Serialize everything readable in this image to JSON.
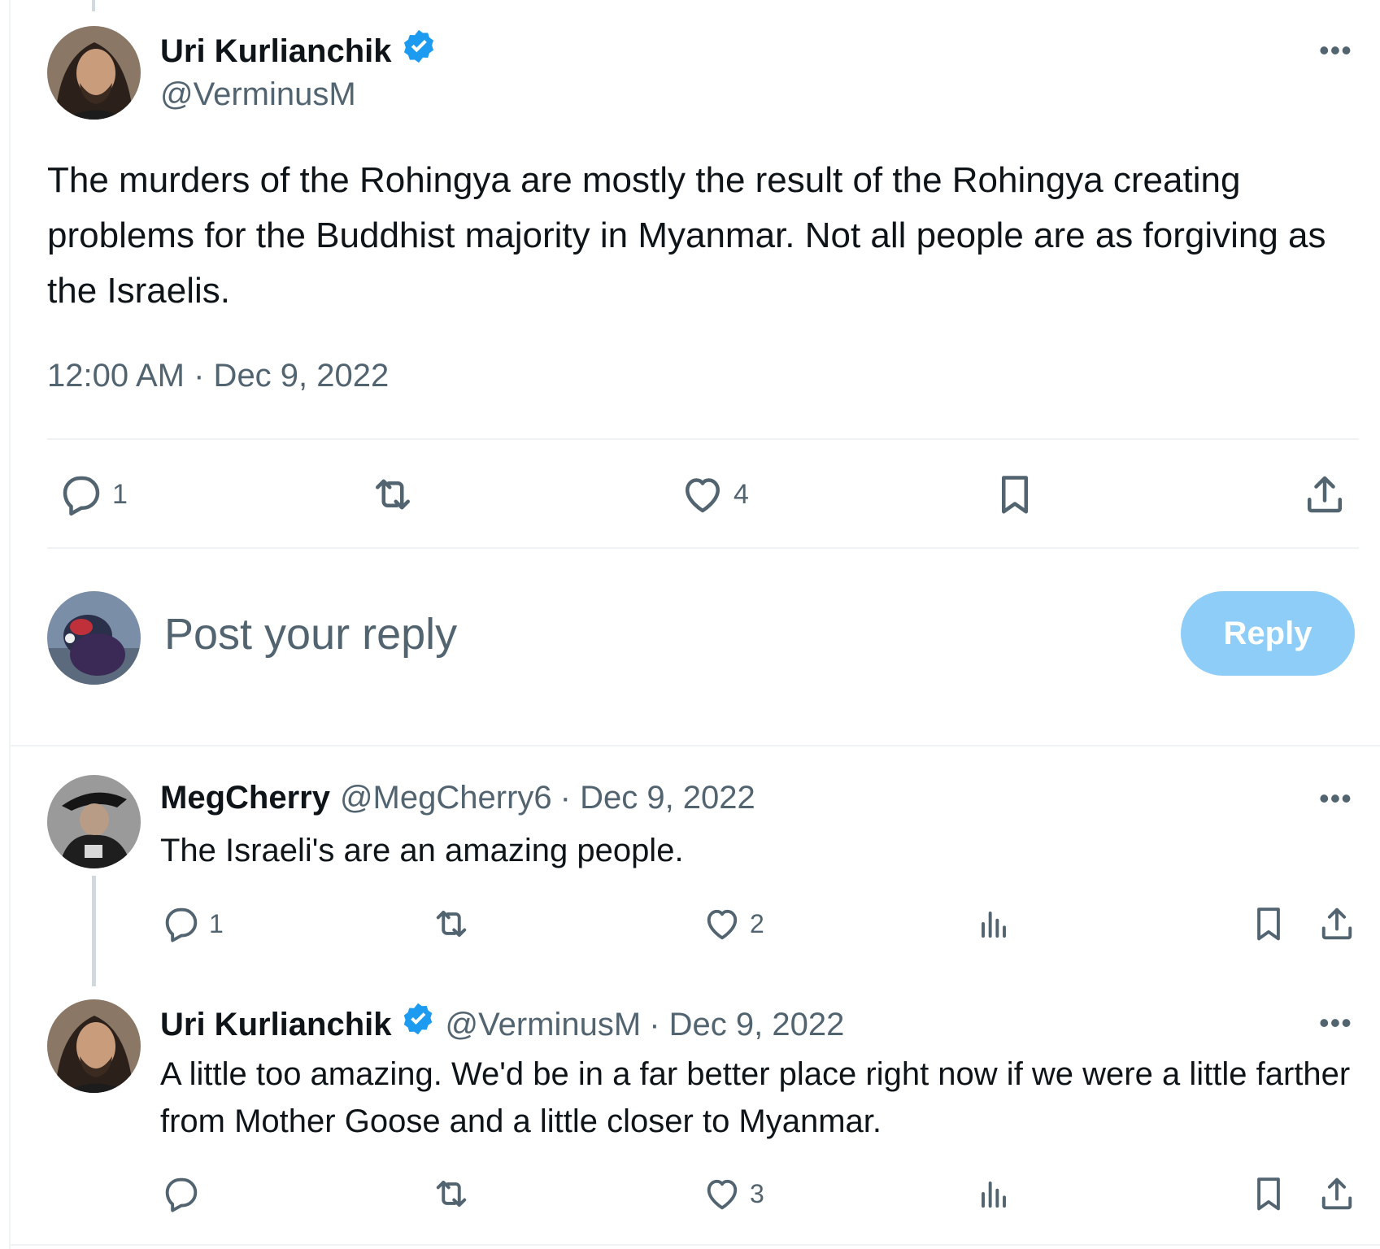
{
  "main_post": {
    "author_name": "Uri Kurlianchik",
    "author_handle": "@VerminusM",
    "verified": true,
    "text": "The murders of the Rohingya are mostly the result of the Rohingya creating problems for the Buddhist majority in Myanmar. Not all people are as forgiving as the Israelis.",
    "timestamp": "12:00 AM · Dec 9, 2022",
    "actions": {
      "reply_count": "1",
      "like_count": "4"
    }
  },
  "composer": {
    "placeholder": "Post your reply",
    "button_label": "Reply"
  },
  "replies": [
    {
      "author_name": "MegCherry",
      "author_handle": "@MegCherry6",
      "meta_sep_date": "· Dec 9, 2022",
      "text": "The Israeli's are an amazing people.",
      "reply_count": "1",
      "like_count": "2"
    },
    {
      "author_name": "Uri Kurlianchik",
      "author_handle": "@VerminusM",
      "verified": true,
      "meta_sep_date": "· Dec 9, 2022",
      "text": "A little too amazing. We'd be in a far better place right now if we were a little farther from Mother Goose and a little closer to Myanmar.",
      "reply_count": "",
      "like_count": "3"
    }
  ],
  "icons": {
    "more": "more-dots-icon",
    "verified": "verified-badge-icon",
    "reply": "reply-bubble-icon",
    "repost": "repost-icon",
    "like": "heart-icon",
    "views": "views-bar-chart-icon",
    "bookmark": "bookmark-icon",
    "share": "share-upload-icon"
  },
  "colors": {
    "accent": "#1d9bf0",
    "reply_button": "#8ecdf8",
    "muted": "#536471",
    "text": "#0f1419",
    "border": "#eff3f4"
  }
}
